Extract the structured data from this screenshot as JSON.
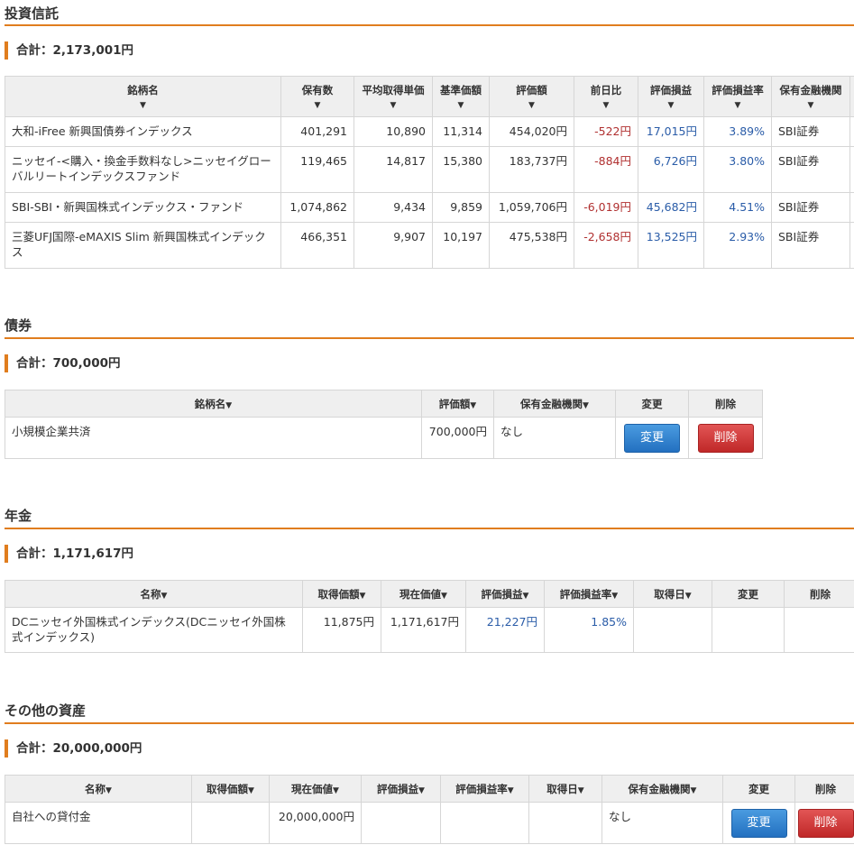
{
  "arrow": "▼",
  "funds": {
    "title": "投資信託",
    "total": "合計：2,173,001円",
    "headers": [
      "銘柄名",
      "保有数",
      "平均取得単価",
      "基準価額",
      "評価額",
      "前日比",
      "評価損益",
      "評価損益率",
      "保有金融機関"
    ],
    "rows": [
      {
        "name": "大和-iFree 新興国債券インデックス",
        "qty": "401,291",
        "avg": "10,890",
        "base": "11,314",
        "value": "454,020円",
        "day": "-522円",
        "gain": "17,015円",
        "rate": "3.89%",
        "inst": "SBI証券"
      },
      {
        "name": "ニッセイ-<購入・換金手数料なし>ニッセイグローバルリートインデックスファンド",
        "qty": "119,465",
        "avg": "14,817",
        "base": "15,380",
        "value": "183,737円",
        "day": "-884円",
        "gain": "6,726円",
        "rate": "3.80%",
        "inst": "SBI証券"
      },
      {
        "name": "SBI-SBI・新興国株式インデックス・ファンド",
        "qty": "1,074,862",
        "avg": "9,434",
        "base": "9,859",
        "value": "1,059,706円",
        "day": "-6,019円",
        "gain": "45,682円",
        "rate": "4.51%",
        "inst": "SBI証券"
      },
      {
        "name": "三菱UFJ国際-eMAXIS Slim 新興国株式インデックス",
        "qty": "466,351",
        "avg": "9,907",
        "base": "10,197",
        "value": "475,538円",
        "day": "-2,658円",
        "gain": "13,525円",
        "rate": "2.93%",
        "inst": "SBI証券"
      }
    ]
  },
  "bonds": {
    "title": "債券",
    "total": "合計：700,000円",
    "headers": [
      "銘柄名",
      "評価額",
      "保有金融機関",
      "変更",
      "削除"
    ],
    "rows": [
      {
        "name": "小規模企業共済",
        "value": "700,000円",
        "inst": "なし",
        "edit": "変更",
        "delete": "削除"
      }
    ]
  },
  "pension": {
    "title": "年金",
    "total": "合計：1,171,617円",
    "headers": [
      "名称",
      "取得価額",
      "現在価値",
      "評価損益",
      "評価損益率",
      "取得日",
      "変更",
      "削除"
    ],
    "rows": [
      {
        "name": "DCニッセイ外国株式インデックス(DCニッセイ外国株式インデックス)",
        "cost": "11,875円",
        "current": "1,171,617円",
        "gain": "21,227円",
        "rate": "1.85%",
        "date": ""
      }
    ]
  },
  "other": {
    "title": "その他の資産",
    "total": "合計：20,000,000円",
    "headers": [
      "名称",
      "取得価額",
      "現在価値",
      "評価損益",
      "評価損益率",
      "取得日",
      "保有金融機関",
      "変更",
      "削除"
    ],
    "rows": [
      {
        "name": "自社への貸付金",
        "cost": "",
        "current": "20,000,000円",
        "gain": "",
        "rate": "",
        "date": "",
        "inst": "なし",
        "edit": "変更",
        "delete": "削除"
      }
    ]
  }
}
